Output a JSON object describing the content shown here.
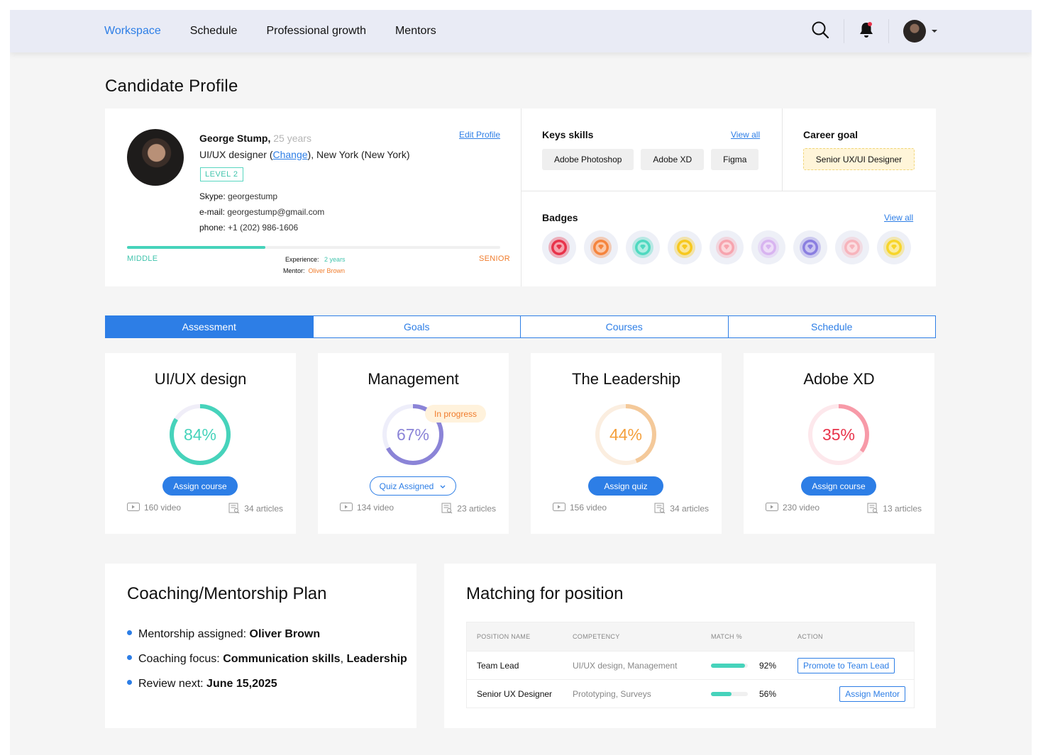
{
  "nav": {
    "items": [
      "Workspace",
      "Schedule",
      "Professional growth",
      "Mentors"
    ]
  },
  "page_title": "Candidate Profile",
  "profile": {
    "name": "George Stump,",
    "age": "25 years",
    "edit_label": "Edit Profile",
    "role_prefix": "UI/UX designer (",
    "change_label": "Change",
    "role_suffix": "), New York (New York)",
    "level": "LEVEL 2",
    "skype_label": "Skype:",
    "skype": "georgestump",
    "email_label": "e-mail:",
    "email": "georgestump@gmail.com",
    "phone_label": "phone:",
    "phone": "+1 (202) 986-1606",
    "progress_fraction": 0.37,
    "level_from": "MIDDLE",
    "level_to": "SENIOR",
    "experience_label": "Experience:",
    "experience": "2 years",
    "mentor_label": "Mentor:",
    "mentor": "Oliver Brown"
  },
  "skills": {
    "title": "Keys skills",
    "view_all": "View all",
    "items": [
      "Adobe Photoshop",
      "Adobe XD",
      "Figma"
    ]
  },
  "career_goal": {
    "title": "Career goal",
    "value": "Senior UX/UI Designer"
  },
  "badges": {
    "title": "Badges",
    "view_all": "View all",
    "colors": [
      "#e8334a",
      "#f5843d",
      "#4fd9c0",
      "#f7c81e",
      "#f7a4ae",
      "#d8b4f0",
      "#8a7ee0",
      "#f7b4bc",
      "#f7d52a"
    ]
  },
  "tabs": [
    "Assessment",
    "Goals",
    "Courses",
    "Schedule"
  ],
  "assessments": [
    {
      "title": "UI/UX design",
      "percent": "84%",
      "value": 84,
      "color": "#46d3bb",
      "track": "#f0eef8",
      "button": "Assign course",
      "videos": "160 video",
      "articles": "34 articles"
    },
    {
      "title": "Management",
      "percent": "67%",
      "value": 67,
      "color": "#8b84d7",
      "track": "#eeeefa",
      "button": "Quiz Assigned",
      "badge": "In progress",
      "videos": "134 video",
      "articles": "23 articles"
    },
    {
      "title": "The Leadership",
      "percent": "44%",
      "value": 44,
      "color": "#f4c99a",
      "track": "#fbeee0",
      "text_color": "#f4a03c",
      "button": "Assign quiz",
      "videos": "156 video",
      "articles": "34 articles"
    },
    {
      "title": "Adobe XD",
      "percent": "35%",
      "value": 35,
      "color": "#f79aa8",
      "track": "#fde8ec",
      "text_color": "#e8334a",
      "button": "Assign course",
      "videos": "230 video",
      "articles": "13 articles"
    }
  ],
  "coaching": {
    "title": "Coaching/Mentorship Plan",
    "items": [
      {
        "label": "Mentorship assigned: ",
        "value": "Oliver Brown"
      },
      {
        "label": "Coaching focus: ",
        "value": "Communication skills",
        "sep": ", ",
        "value2": "Leadership"
      },
      {
        "label": "Review next: ",
        "value": "June 15,2025"
      }
    ]
  },
  "matching": {
    "title": "Matching for position",
    "headers": [
      "POSITION NAME",
      "COMPETENCY",
      "MATCH %",
      "ACTION"
    ],
    "rows": [
      {
        "position": "Team Lead",
        "competency": "UI/UX design, Management",
        "match": "92%",
        "match_value": 92,
        "action": "Promote to Team Lead"
      },
      {
        "position": "Senior UX Designer",
        "competency": "Prototyping, Surveys",
        "match": "56%",
        "match_value": 56,
        "action": "Assign Mentor"
      }
    ]
  }
}
